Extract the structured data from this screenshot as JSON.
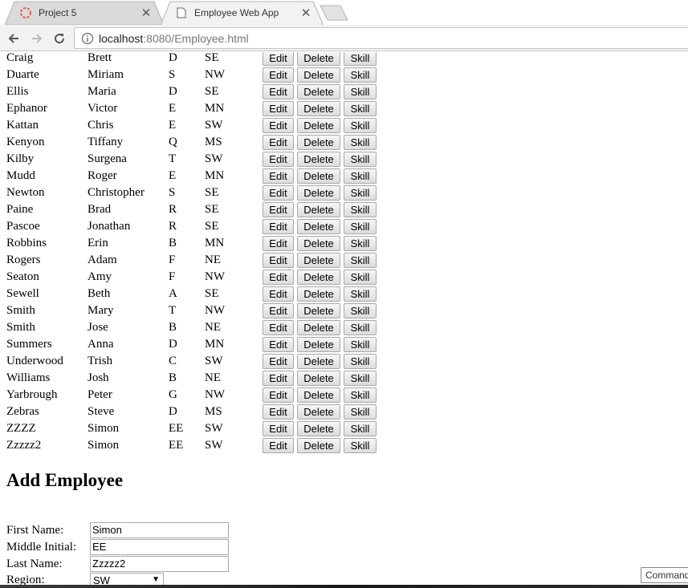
{
  "browser": {
    "tabs": [
      {
        "title": "Project 5",
        "active": false
      },
      {
        "title": "Employee Web App",
        "active": true
      }
    ],
    "url_host": "localhost",
    "url_path": ":8080/Employee.html"
  },
  "table": {
    "buttons": {
      "edit": "Edit",
      "delete": "Delete",
      "skill": "Skill"
    },
    "rows": [
      {
        "last": "Craig",
        "first": "Brett",
        "mi": "D",
        "region": "SE"
      },
      {
        "last": "Duarte",
        "first": "Miriam",
        "mi": "S",
        "region": "NW"
      },
      {
        "last": "Ellis",
        "first": "Maria",
        "mi": "D",
        "region": "SE"
      },
      {
        "last": "Ephanor",
        "first": "Victor",
        "mi": "E",
        "region": "MN"
      },
      {
        "last": "Kattan",
        "first": "Chris",
        "mi": "E",
        "region": "SW"
      },
      {
        "last": "Kenyon",
        "first": "Tiffany",
        "mi": "Q",
        "region": "MS"
      },
      {
        "last": "Kilby",
        "first": "Surgena",
        "mi": "T",
        "region": "SW"
      },
      {
        "last": "Mudd",
        "first": "Roger",
        "mi": "E",
        "region": "MN"
      },
      {
        "last": "Newton",
        "first": "Christopher",
        "mi": "S",
        "region": "SE"
      },
      {
        "last": "Paine",
        "first": "Brad",
        "mi": "R",
        "region": "SE"
      },
      {
        "last": "Pascoe",
        "first": "Jonathan",
        "mi": "R",
        "region": "SE"
      },
      {
        "last": "Robbins",
        "first": "Erin",
        "mi": "B",
        "region": "MN"
      },
      {
        "last": "Rogers",
        "first": "Adam",
        "mi": "F",
        "region": "NE"
      },
      {
        "last": "Seaton",
        "first": "Amy",
        "mi": "F",
        "region": "NW"
      },
      {
        "last": "Sewell",
        "first": "Beth",
        "mi": "A",
        "region": "SE"
      },
      {
        "last": "Smith",
        "first": "Mary",
        "mi": "T",
        "region": "NW"
      },
      {
        "last": "Smith",
        "first": "Jose",
        "mi": "B",
        "region": "NE"
      },
      {
        "last": "Summers",
        "first": "Anna",
        "mi": "D",
        "region": "MN"
      },
      {
        "last": "Underwood",
        "first": "Trish",
        "mi": "C",
        "region": "SW"
      },
      {
        "last": "Williams",
        "first": "Josh",
        "mi": "B",
        "region": "NE"
      },
      {
        "last": "Yarbrough",
        "first": "Peter",
        "mi": "G",
        "region": "NW"
      },
      {
        "last": "Zebras",
        "first": "Steve",
        "mi": "D",
        "region": "MS"
      },
      {
        "last": "ZZZZ",
        "first": "Simon",
        "mi": "EE",
        "region": "SW"
      },
      {
        "last": "Zzzzz2",
        "first": "Simon",
        "mi": "EE",
        "region": "SW"
      }
    ]
  },
  "form": {
    "heading": "Add Employee",
    "first_name_label": "First Name:",
    "first_name_value": "Simon",
    "middle_initial_label": "Middle Initial:",
    "middle_initial_value": "EE",
    "last_name_label": "Last Name:",
    "last_name_value": "Zzzzz2",
    "region_label": "Region:",
    "region_value": "SW"
  },
  "tooltip": "Command"
}
